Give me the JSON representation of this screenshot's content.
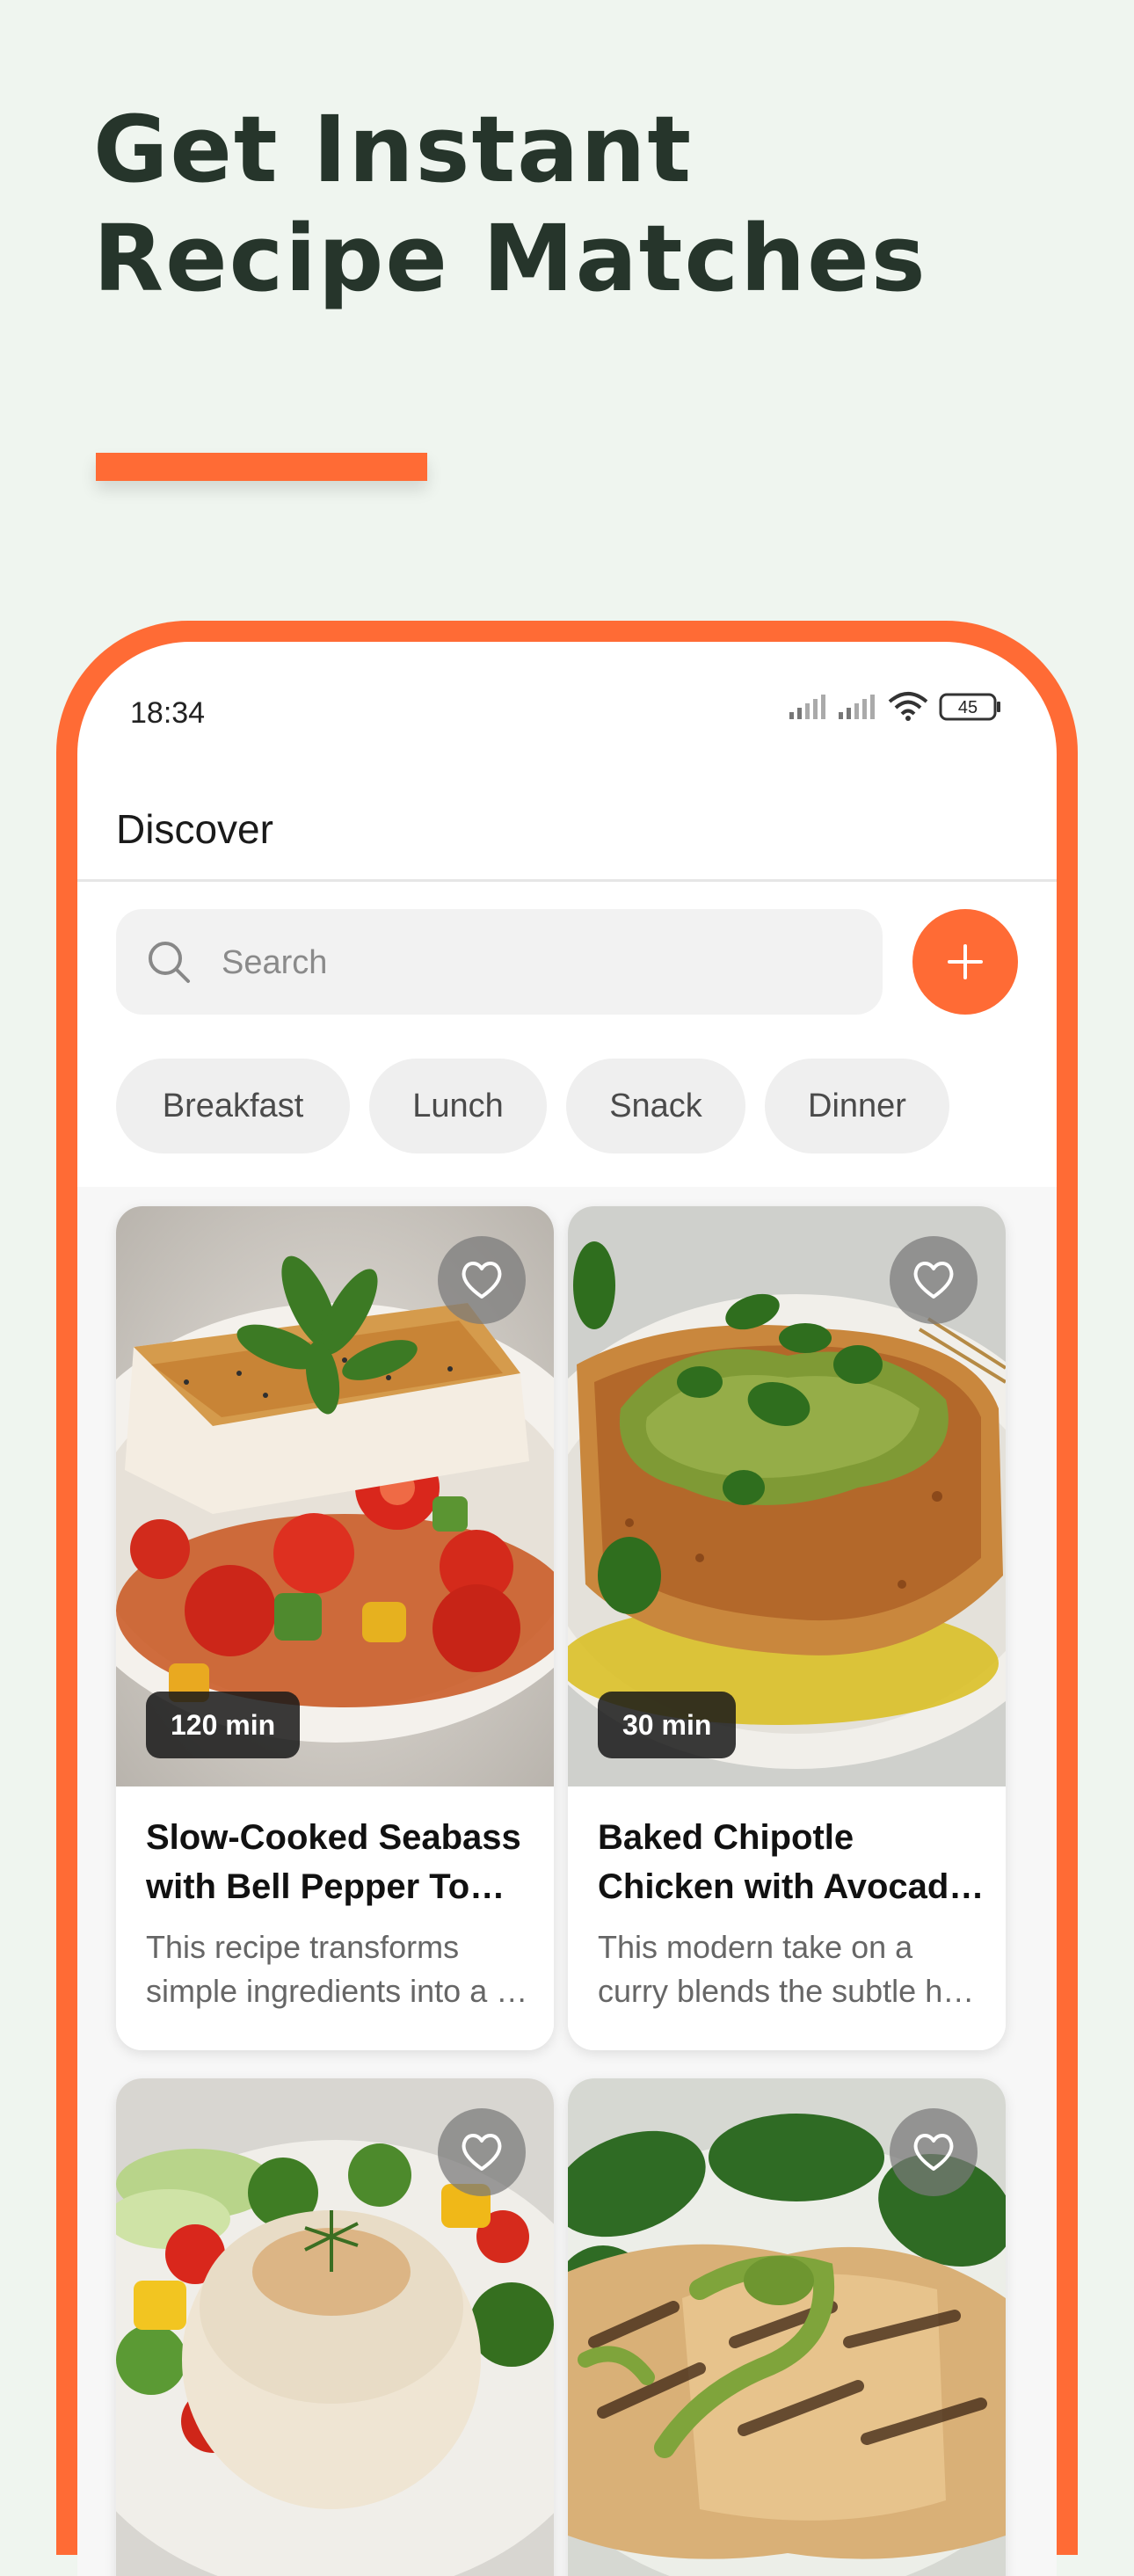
{
  "hero": {
    "line1": "Get Instant",
    "line2": "Recipe Matches"
  },
  "colors": {
    "accent": "#ff6b35",
    "background": "#eff5ef",
    "headline": "#26352b"
  },
  "status_bar": {
    "time": "18:34",
    "battery": "45",
    "icons": [
      "signal-icon",
      "signal-icon",
      "wifi-icon",
      "battery-icon"
    ]
  },
  "app": {
    "title": "Discover"
  },
  "search": {
    "placeholder": "Search",
    "icon": "search-icon"
  },
  "add_button": {
    "icon": "plus-icon"
  },
  "filters": [
    {
      "label": "Breakfast"
    },
    {
      "label": "Lunch"
    },
    {
      "label": "Snack"
    },
    {
      "label": "Dinner"
    }
  ],
  "recipes": [
    {
      "time": "120 min",
      "title_line1": "Slow-Cooked Seabass",
      "title_line2": "with Bell Pepper Tom…",
      "desc_line1": "This recipe transforms",
      "desc_line2": "simple ingredients into a …",
      "icon": "heart-icon"
    },
    {
      "time": "30 min",
      "title_line1": "Baked Chipotle",
      "title_line2": "Chicken with Avocad…",
      "desc_line1": "This modern take on a",
      "desc_line2": "curry blends the subtle h…",
      "icon": "heart-icon"
    },
    {
      "icon": "heart-icon"
    },
    {
      "icon": "heart-icon"
    }
  ]
}
